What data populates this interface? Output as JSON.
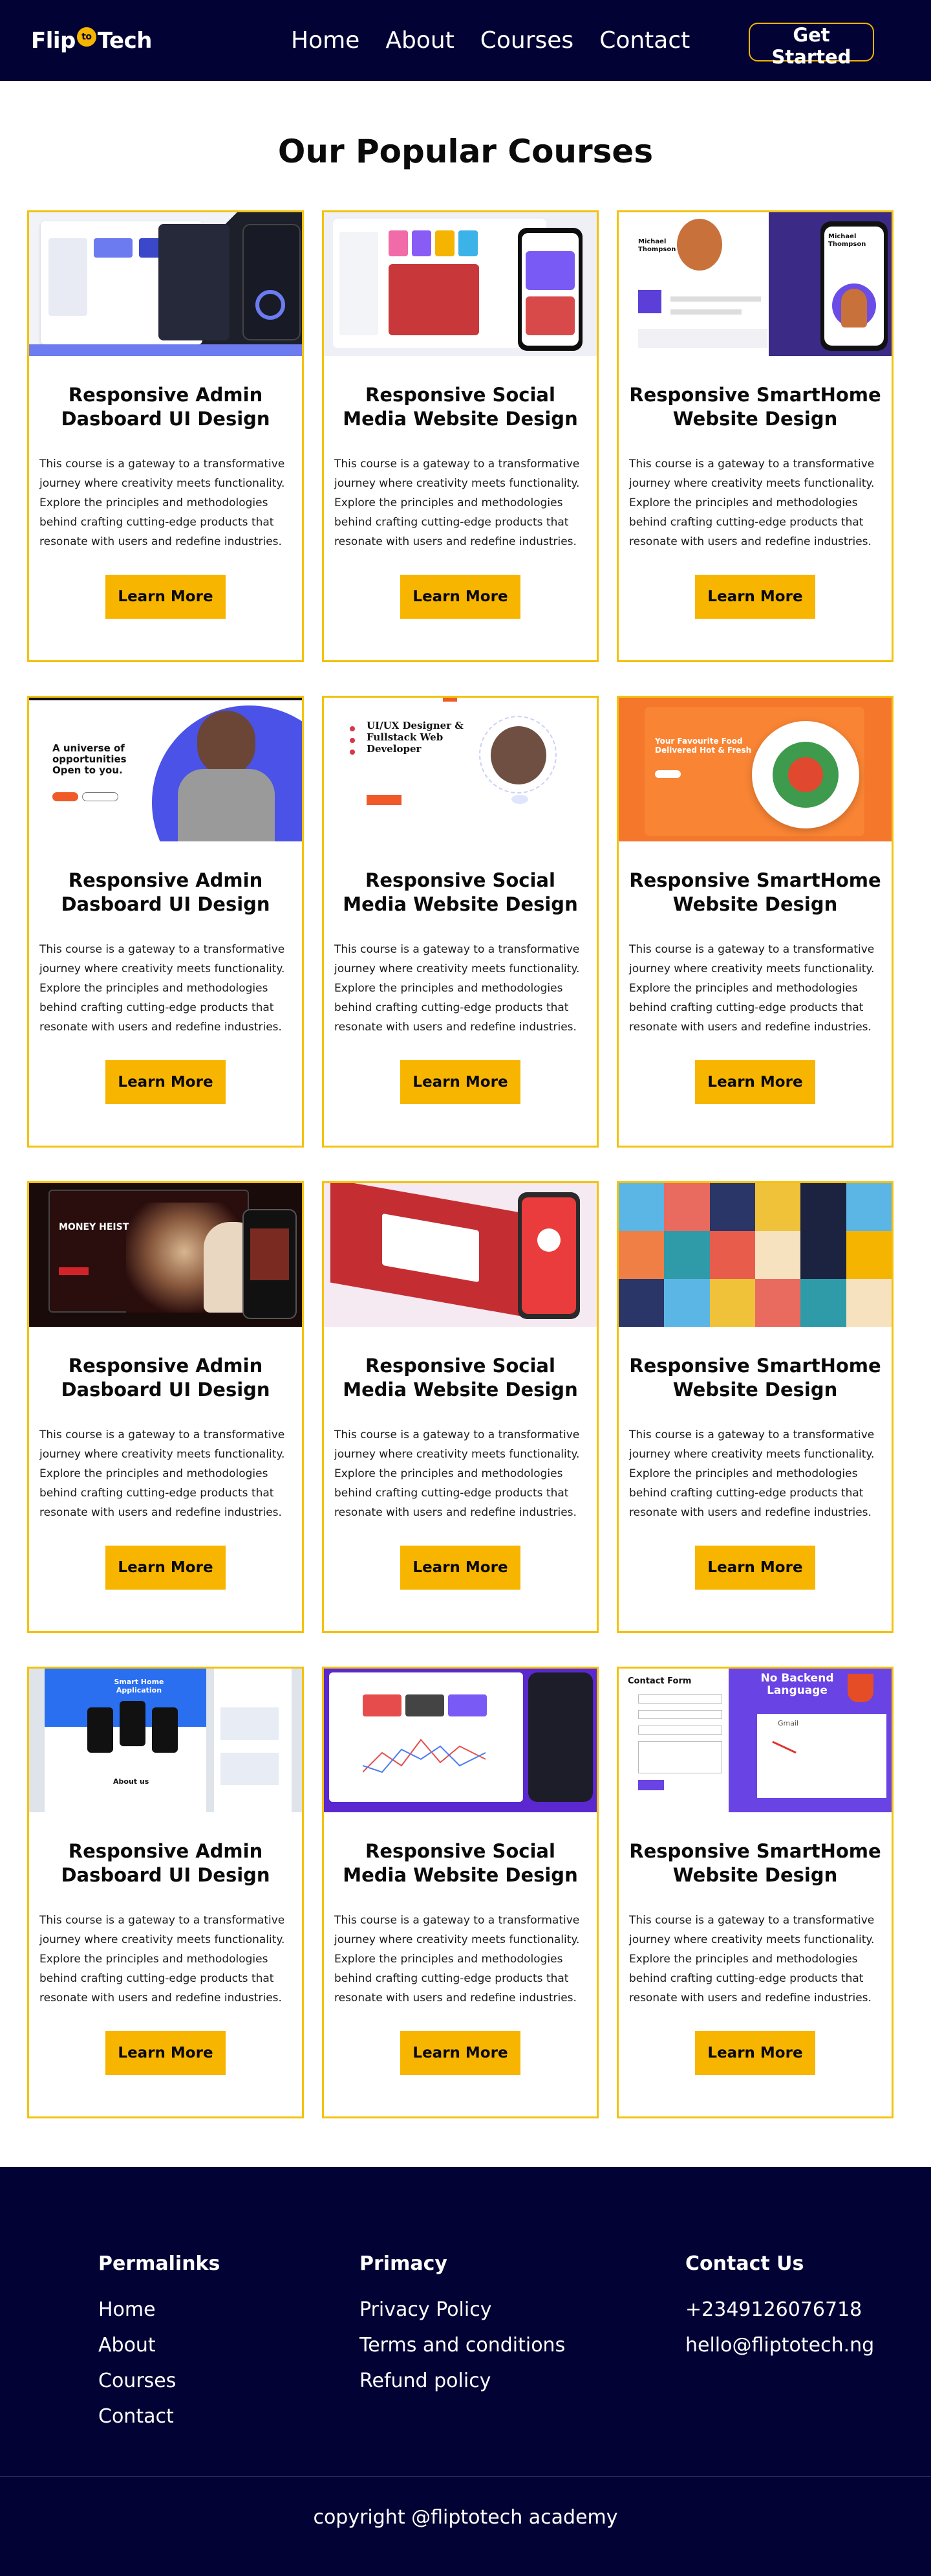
{
  "header": {
    "logo_prefix": "Flip",
    "logo_to": "to",
    "logo_suffix": "Tech",
    "nav": [
      "Home",
      "About",
      "Courses",
      "Contact"
    ],
    "cta_label": "Get Started"
  },
  "courses_section": {
    "title": "Our Popular Courses",
    "description": "This course is a gateway to a transformative journey where creativity meets functionality. Explore the principles and methodologies behind crafting cutting-edge products that resonate with users and redefine industries.",
    "button_label": "Learn More",
    "cards": [
      {
        "title": "Responsive Admin Dasboard UI Design",
        "thumb": "admin-dashboard"
      },
      {
        "title": "Responsive Social Media Website Design",
        "thumb": "social-media-app"
      },
      {
        "title": "Responsive SmartHome Website Design",
        "thumb": "portfolio-michael-thompson"
      },
      {
        "title": "Responsive Admin Dasboard UI Design",
        "thumb": "a-universe-of-opportunities"
      },
      {
        "title": "Responsive Social Media Website Design",
        "thumb": "uiux-designer-portfolio"
      },
      {
        "title": "Responsive SmartHome Website Design",
        "thumb": "food-delivery-landing"
      },
      {
        "title": "Responsive Admin Dasboard UI Design",
        "thumb": "money-heist-streaming"
      },
      {
        "title": "Responsive Social Media Website Design",
        "thumb": "red-mobile-mockup"
      },
      {
        "title": "Responsive SmartHome Website Design",
        "thumb": "icon-set-grid"
      },
      {
        "title": "Responsive Admin Dasboard UI Design",
        "thumb": "smart-home-application"
      },
      {
        "title": "Responsive Social Media Website Design",
        "thumb": "analytics-dashboard"
      },
      {
        "title": "Responsive SmartHome Website Design",
        "thumb": "contact-form-no-backend"
      }
    ],
    "thumb_text": {
      "smart_name": "Michael Thompson",
      "universe": "A universe of opportunities Open to you.",
      "uiux": "UI/UX Designer & Fullstack Web Developer",
      "food": "Your Favourite Food Delivered Hot & Fresh",
      "heist": "MONEY HEIST",
      "home_app": "Smart Home Application",
      "about_us": "About us",
      "form_title": "Contact Form",
      "form_badge": "No Backend Language",
      "gmail": "Gmail"
    }
  },
  "footer": {
    "permalinks_title": "Permalinks",
    "permalinks": [
      "Home",
      "About",
      "Courses",
      "Contact"
    ],
    "primacy_title": "Primacy",
    "primacy": [
      "Privacy Policy",
      "Terms and conditions",
      "Refund policy"
    ],
    "contact_title": "Contact Us",
    "phone": "+2349126076718",
    "email": "hello@fliptotech.ng",
    "copyright": "copyright @fliptotech academy"
  },
  "colors": {
    "navy": "#020235",
    "accent_yellow": "#f7b500",
    "card_border": "#f4c20d"
  }
}
